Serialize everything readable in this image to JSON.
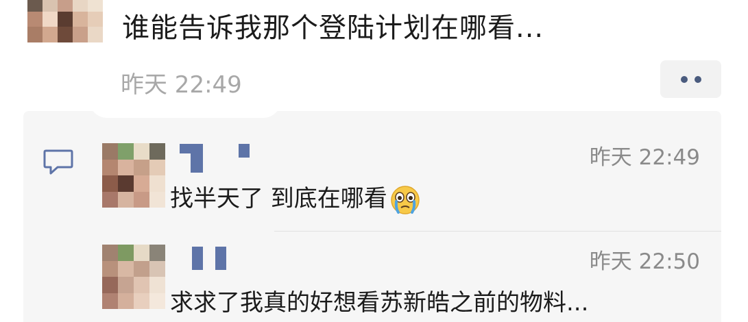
{
  "post": {
    "text": "谁能告诉我那个登陆计划在哪看...",
    "time": "昨天 22:49"
  },
  "comments": [
    {
      "time": "昨天 22:49",
      "text": "找半天了 到底在哪看"
    },
    {
      "time": "昨天 22:50",
      "text": "求求了我真的好想看苏新皓之前的物料..."
    }
  ],
  "colors": {
    "name_link": "#5e74a8",
    "more_dots": "#4a5b7e",
    "panel_bg": "#f6f6f6"
  }
}
